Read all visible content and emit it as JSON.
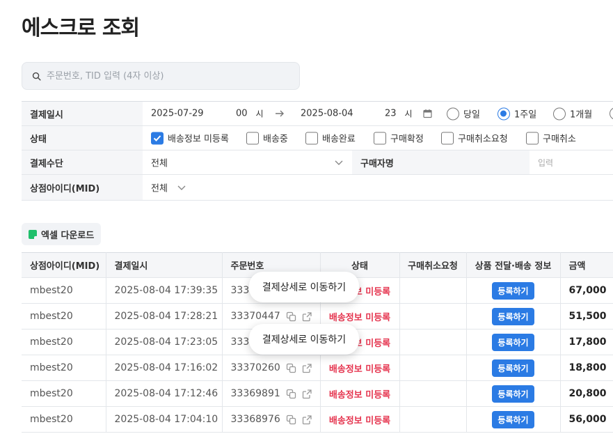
{
  "page_title": "에스크로 조회",
  "search": {
    "placeholder": "주문번호, TID 입력 (4자 이상)"
  },
  "filter": {
    "date_label": "결제일시",
    "start_date": "2025-07-29",
    "start_hour": "00",
    "hour_unit": "시",
    "end_date": "2025-08-04",
    "end_hour": "23",
    "periods": [
      {
        "label": "당일",
        "selected": false
      },
      {
        "label": "1주일",
        "selected": true
      },
      {
        "label": "1개월",
        "selected": false
      }
    ],
    "status_label": "상태",
    "statuses": [
      {
        "label": "배송정보 미등록",
        "checked": true
      },
      {
        "label": "배송중",
        "checked": false
      },
      {
        "label": "배송완료",
        "checked": false
      },
      {
        "label": "구매확정",
        "checked": false
      },
      {
        "label": "구매취소요청",
        "checked": false
      },
      {
        "label": "구매취소",
        "checked": false
      }
    ],
    "payment_label": "결제수단",
    "payment_value": "전체",
    "buyer_label": "구매자명",
    "buyer_placeholder": "입력",
    "mid_label": "상점아이디(MID)",
    "mid_value": "전체"
  },
  "excel_button": "엑셀 다운로드",
  "table": {
    "headers": [
      "상점아이디(MID)",
      "결제일시",
      "주문번호",
      "상태",
      "구매취소요청",
      "상품 전달·배송 정보",
      "금액"
    ],
    "register_label": "등록하기",
    "rows": [
      {
        "mid": "mbest20",
        "datetime": "2025-08-04 17:39:35",
        "order": "33370",
        "status": "배송정보 미등록",
        "amount": "67,000"
      },
      {
        "mid": "mbest20",
        "datetime": "2025-08-04 17:28:21",
        "order": "33370447",
        "status": "배송정보 미등록",
        "amount": "51,500"
      },
      {
        "mid": "mbest20",
        "datetime": "2025-08-04 17:23:05",
        "order": "33370",
        "status": "배송정보 미등록",
        "amount": "17,800"
      },
      {
        "mid": "mbest20",
        "datetime": "2025-08-04 17:16:02",
        "order": "33370260",
        "status": "배송정보 미등록",
        "amount": "18,800"
      },
      {
        "mid": "mbest20",
        "datetime": "2025-08-04 17:12:46",
        "order": "33369891",
        "status": "배송정보 미등록",
        "amount": "20,800"
      },
      {
        "mid": "mbest20",
        "datetime": "2025-08-04 17:04:10",
        "order": "33368976",
        "status": "배송정보 미등록",
        "amount": "56,000"
      }
    ]
  },
  "tooltip_text": "결제상세로 이동하기",
  "colors": {
    "accent": "#2b7be4",
    "status_red": "#e5354f",
    "excel_green": "#1fbf6b"
  }
}
